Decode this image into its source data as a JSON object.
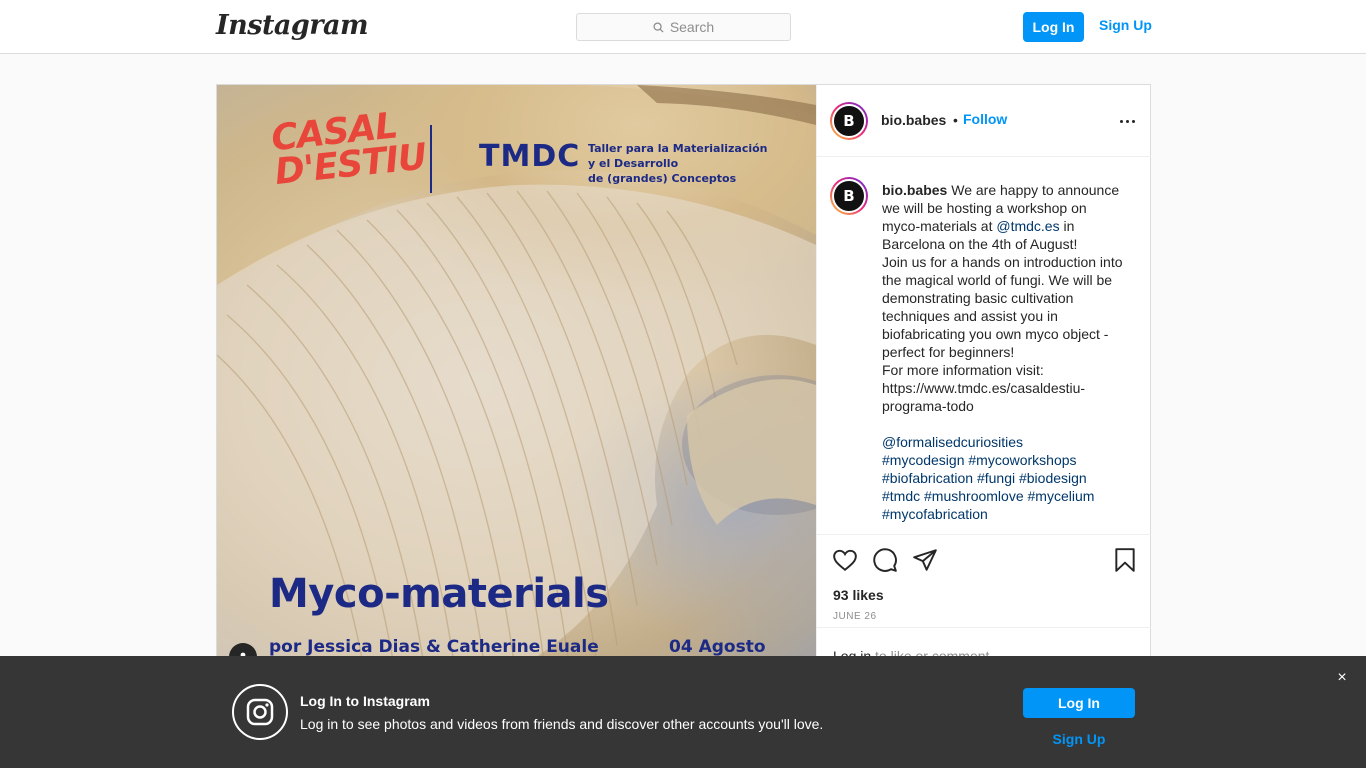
{
  "header": {
    "logo": "Instagram",
    "search_placeholder": "Search",
    "login_label": "Log In",
    "signup_label": "Sign Up"
  },
  "post": {
    "username": "bio.babes",
    "follow_label": "Follow",
    "separator": "•",
    "poster": {
      "brand": "CASAL D'ESTIU",
      "org": "TMDC",
      "org_full": [
        "Taller para la Materialización",
        "y el Desarrollo",
        "de (grandes) Conceptos"
      ],
      "title": "Myco-materials",
      "authors": "por Jessica Dias & Catherine Euale",
      "date": "04 Agosto"
    },
    "caption": {
      "username": "bio.babes",
      "lines": [
        " We are happy to announce",
        "we will be hosting a workshop on",
        "myco-materials at ",
        "@tmdc.es",
        " in",
        "Barcelona on the 4th of August!",
        "Join us for a hands on introduction into",
        "the magical world of fungi. We will be",
        "demonstrating basic cultivation",
        "techniques and assist you in",
        "biofabricating you own myco object -",
        "perfect for beginners!",
        "For more information visit:",
        "https://www.tmdc.es/casaldestiu-",
        "programa-todo"
      ],
      "tags": [
        "@formalisedcuriosities",
        "#mycodesign #mycoworkshops",
        "#biofabrication #fungi #biodesign",
        "#tmdc #mushroomlove #mycelium",
        "#mycofabrication"
      ]
    },
    "likes": "93 likes",
    "date": "JUNE 26",
    "comment_login": "Log in",
    "comment_suffix": " to like or comment."
  },
  "banner": {
    "title": "Log In to Instagram",
    "text": "Log in to see photos and videos from friends and discover other accounts you'll love.",
    "login_label": "Log In",
    "signup_label": "Sign Up",
    "close": "×"
  },
  "colors": {
    "accent": "#0095f6",
    "poster_blue": "#1c2a86",
    "poster_red": "#e8463a",
    "banner_bg": "#363636"
  }
}
